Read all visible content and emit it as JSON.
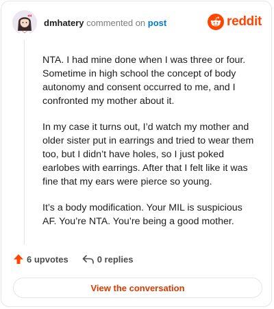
{
  "header": {
    "username": "dmhatery",
    "action_text": "commented on",
    "post_link": "post",
    "brand": "reddit",
    "brand_color": "#ff4500",
    "link_color": "#0079d3"
  },
  "comment": {
    "paragraphs": [
      "NTA. I had mine done when I was three or four. Sometime in high school the concept of body autonomy and consent occurred to me, and I confronted my mother about it.",
      "In my case it turns out, I’d watch my mother and older sister put in earrings and tried to wear them too, but I didn’t have holes, so I just poked earlobes with earrings. After that I felt like it was fine that my ears were pierce so young.",
      "It’s a body modification. Your MIL is suspicious AF. You’re NTA. You’re being a good mother."
    ]
  },
  "footer": {
    "upvotes": "6 upvotes",
    "replies": "0 replies",
    "upvote_icon": "upvote-arrow-icon",
    "reply_icon": "reply-arrow-icon",
    "view_button": "View the conversation",
    "accent_color": "#d93a00"
  }
}
